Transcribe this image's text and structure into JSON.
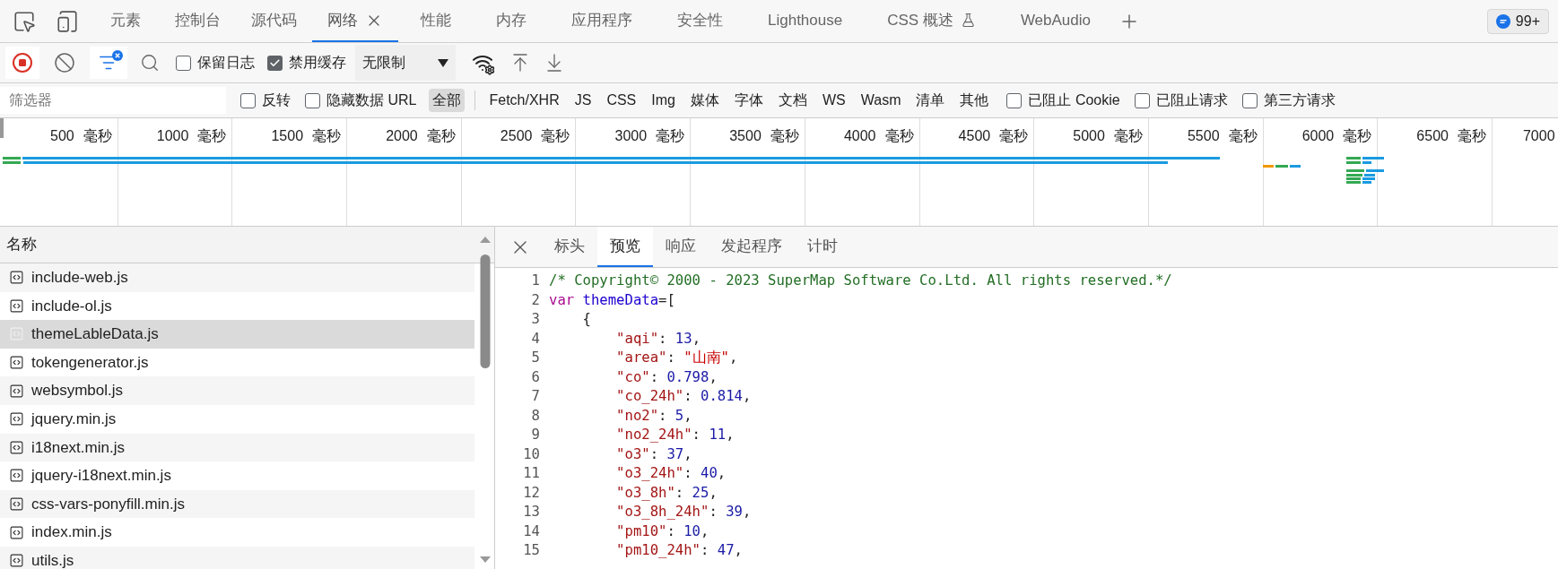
{
  "main_tabs": [
    {
      "label": "元素",
      "selected": false,
      "closable": false
    },
    {
      "label": "控制台",
      "selected": false,
      "closable": false
    },
    {
      "label": "源代码",
      "selected": false,
      "closable": false
    },
    {
      "label": "网络",
      "selected": true,
      "closable": true
    },
    {
      "label": "性能",
      "selected": false,
      "closable": false
    },
    {
      "label": "内存",
      "selected": false,
      "closable": false
    },
    {
      "label": "应用程序",
      "selected": false,
      "closable": false
    },
    {
      "label": "安全性",
      "selected": false,
      "closable": false
    },
    {
      "label": "Lighthouse",
      "selected": false,
      "closable": false
    },
    {
      "label": "CSS 概述",
      "selected": false,
      "closable": false,
      "experimental": true
    },
    {
      "label": "WebAudio",
      "selected": false,
      "closable": false
    }
  ],
  "issues_badge": "99+",
  "toolbar": {
    "recording": true,
    "filter_active": true,
    "checkboxes": [
      {
        "label": "保留日志",
        "checked": false
      },
      {
        "label": "禁用缓存",
        "checked": true
      }
    ],
    "throttling": "无限制"
  },
  "filter_bar": {
    "placeholder": "筛选器",
    "options": [
      {
        "label": "反转",
        "checked": false
      },
      {
        "label": "隐藏数据 URL",
        "checked": false
      }
    ],
    "types": [
      {
        "label": "全部",
        "selected": true
      },
      {
        "label": "Fetch/XHR",
        "selected": false
      },
      {
        "label": "JS",
        "selected": false
      },
      {
        "label": "CSS",
        "selected": false
      },
      {
        "label": "Img",
        "selected": false
      },
      {
        "label": "媒体",
        "selected": false
      },
      {
        "label": "字体",
        "selected": false
      },
      {
        "label": "文档",
        "selected": false
      },
      {
        "label": "WS",
        "selected": false
      },
      {
        "label": "Wasm",
        "selected": false
      },
      {
        "label": "清单",
        "selected": false
      },
      {
        "label": "其他",
        "selected": false
      }
    ],
    "blocks": [
      {
        "label": "已阻止 Cookie",
        "checked": false
      },
      {
        "label": "已阻止请求",
        "checked": false
      },
      {
        "label": "第三方请求",
        "checked": false
      }
    ]
  },
  "timeline": {
    "ticks": [
      {
        "value": "500",
        "unit": "毫秒"
      },
      {
        "value": "1000",
        "unit": "毫秒"
      },
      {
        "value": "1500",
        "unit": "毫秒"
      },
      {
        "value": "2000",
        "unit": "毫秒"
      },
      {
        "value": "2500",
        "unit": "毫秒"
      },
      {
        "value": "3000",
        "unit": "毫秒"
      },
      {
        "value": "3500",
        "unit": "毫秒"
      },
      {
        "value": "4000",
        "unit": "毫秒"
      },
      {
        "value": "4500",
        "unit": "毫秒"
      },
      {
        "value": "5000",
        "unit": "毫秒"
      },
      {
        "value": "5500",
        "unit": "毫秒"
      },
      {
        "value": "6000",
        "unit": "毫秒"
      },
      {
        "value": "6500",
        "unit": "毫秒"
      }
    ],
    "last_tick": "7000"
  },
  "requests": {
    "column": "名称",
    "rows": [
      {
        "name": "include-web.js",
        "selected": false
      },
      {
        "name": "include-ol.js",
        "selected": false
      },
      {
        "name": "themeLableData.js",
        "selected": true
      },
      {
        "name": "tokengenerator.js",
        "selected": false
      },
      {
        "name": "websymbol.js",
        "selected": false
      },
      {
        "name": "jquery.min.js",
        "selected": false
      },
      {
        "name": "i18next.min.js",
        "selected": false
      },
      {
        "name": "jquery-i18next.min.js",
        "selected": false
      },
      {
        "name": "css-vars-ponyfill.min.js",
        "selected": false
      },
      {
        "name": "index.min.js",
        "selected": false
      },
      {
        "name": "utils.js",
        "selected": false
      }
    ]
  },
  "detail": {
    "tabs": [
      {
        "label": "标头",
        "selected": false
      },
      {
        "label": "预览",
        "selected": true
      },
      {
        "label": "响应",
        "selected": false
      },
      {
        "label": "发起程序",
        "selected": false
      },
      {
        "label": "计时",
        "selected": false
      }
    ],
    "lines": [
      {
        "number": "1",
        "tokens": [
          {
            "kind": "comment",
            "text": "/* Copyright© 2000 - 2023 SuperMap Software Co.Ltd. All rights reserved.*/"
          }
        ]
      },
      {
        "number": "2",
        "tokens": [
          {
            "kind": "keyword",
            "text": "var"
          },
          {
            "kind": "variable",
            "text": "themeData"
          },
          {
            "kind": "plain",
            "text": "=["
          }
        ]
      },
      {
        "number": "3",
        "tokens": [
          {
            "kind": "plain",
            "text": "    {"
          }
        ]
      },
      {
        "number": "4",
        "tokens": [
          {
            "kind": "key",
            "text": "        \"aqi\""
          },
          {
            "kind": "plain",
            "text": ": "
          },
          {
            "kind": "number",
            "text": "13"
          },
          {
            "kind": "plain",
            "text": ","
          }
        ]
      },
      {
        "number": "5",
        "tokens": [
          {
            "kind": "key",
            "text": "        \"area\""
          },
          {
            "kind": "plain",
            "text": ": "
          },
          {
            "kind": "string",
            "text": "\"山南\""
          },
          {
            "kind": "plain",
            "text": ","
          }
        ]
      },
      {
        "number": "6",
        "tokens": [
          {
            "kind": "key",
            "text": "        \"co\""
          },
          {
            "kind": "plain",
            "text": ": "
          },
          {
            "kind": "number",
            "text": "0.798"
          },
          {
            "kind": "plain",
            "text": ","
          }
        ]
      },
      {
        "number": "7",
        "tokens": [
          {
            "kind": "key",
            "text": "        \"co_24h\""
          },
          {
            "kind": "plain",
            "text": ": "
          },
          {
            "kind": "number",
            "text": "0.814"
          },
          {
            "kind": "plain",
            "text": ","
          }
        ]
      },
      {
        "number": "8",
        "tokens": [
          {
            "kind": "key",
            "text": "        \"no2\""
          },
          {
            "kind": "plain",
            "text": ": "
          },
          {
            "kind": "number",
            "text": "5"
          },
          {
            "kind": "plain",
            "text": ","
          }
        ]
      },
      {
        "number": "9",
        "tokens": [
          {
            "kind": "key",
            "text": "        \"no2_24h\""
          },
          {
            "kind": "plain",
            "text": ": "
          },
          {
            "kind": "number",
            "text": "11"
          },
          {
            "kind": "plain",
            "text": ","
          }
        ]
      },
      {
        "number": "10",
        "tokens": [
          {
            "kind": "key",
            "text": "        \"o3\""
          },
          {
            "kind": "plain",
            "text": ": "
          },
          {
            "kind": "number",
            "text": "37"
          },
          {
            "kind": "plain",
            "text": ","
          }
        ]
      },
      {
        "number": "11",
        "tokens": [
          {
            "kind": "key",
            "text": "        \"o3_24h\""
          },
          {
            "kind": "plain",
            "text": ": "
          },
          {
            "kind": "number",
            "text": "40"
          },
          {
            "kind": "plain",
            "text": ","
          }
        ]
      },
      {
        "number": "12",
        "tokens": [
          {
            "kind": "key",
            "text": "        \"o3_8h\""
          },
          {
            "kind": "plain",
            "text": ": "
          },
          {
            "kind": "number",
            "text": "25"
          },
          {
            "kind": "plain",
            "text": ","
          }
        ]
      },
      {
        "number": "13",
        "tokens": [
          {
            "kind": "key",
            "text": "        \"o3_8h_24h\""
          },
          {
            "kind": "plain",
            "text": ": "
          },
          {
            "kind": "number",
            "text": "39"
          },
          {
            "kind": "plain",
            "text": ","
          }
        ]
      },
      {
        "number": "14",
        "tokens": [
          {
            "kind": "key",
            "text": "        \"pm10\""
          },
          {
            "kind": "plain",
            "text": ": "
          },
          {
            "kind": "number",
            "text": "10"
          },
          {
            "kind": "plain",
            "text": ","
          }
        ]
      },
      {
        "number": "15",
        "tokens": [
          {
            "kind": "key",
            "text": "        \"pm10_24h\""
          },
          {
            "kind": "plain",
            "text": ": "
          },
          {
            "kind": "number",
            "text": "47"
          },
          {
            "kind": "plain",
            "text": ","
          }
        ]
      }
    ]
  }
}
